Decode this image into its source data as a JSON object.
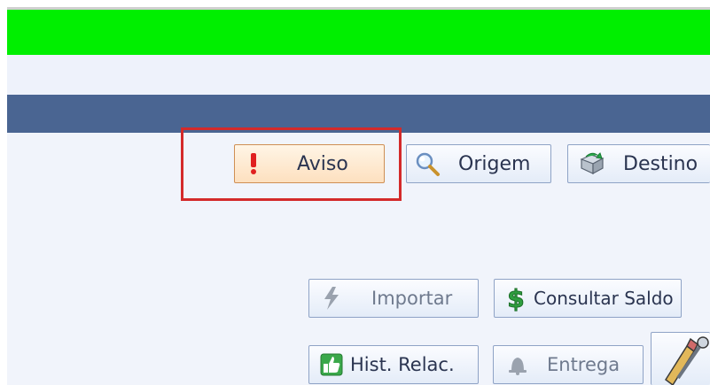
{
  "header": {
    "accent_color": "#00ef00",
    "bar_color": "#4a6592"
  },
  "toolbar": {
    "aviso_label": "Aviso",
    "origem_label": "Origem",
    "destino_label": "Destino"
  },
  "actions": {
    "importar_label": "Importar",
    "importar_enabled": false,
    "consultar_saldo_label": "Consultar Saldo",
    "hist_relac_label": "Hist. Relac.",
    "entrega_label": "Entrega",
    "entrega_enabled": false
  },
  "icons": {
    "aviso": "exclamation-icon",
    "origem": "magnifier-icon",
    "destino": "map-arrow-icon",
    "importar": "lightning-icon",
    "consultar_saldo": "dollar-icon",
    "hist_relac": "thumbs-up-icon",
    "entrega": "bell-icon",
    "tools": "pencil-tools-icon"
  },
  "highlight": {
    "target": "aviso-button",
    "color": "#d42a2a"
  }
}
